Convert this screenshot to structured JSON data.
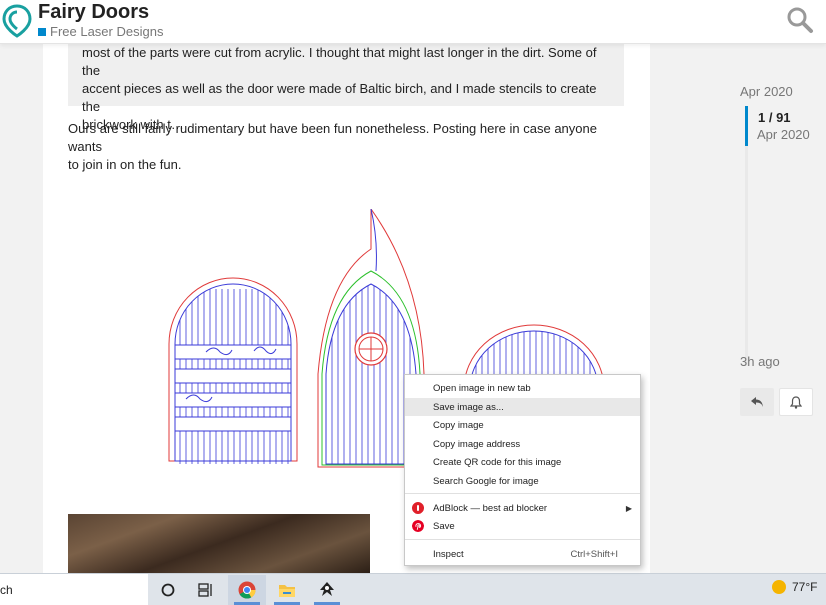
{
  "header": {
    "title": "Fairy Doors",
    "category": "Free Laser Designs",
    "category_color": "#0088cc",
    "logo_icon": "map-pin-logo-icon",
    "search_icon": "search-icon"
  },
  "post": {
    "quote_lines": [
      "most of the parts were cut from acrylic. I thought that might last longer in the dirt. Some of the",
      "accent pieces as well as the door were made of Baltic birch, and I made stencils to create the",
      "brickwork with t…"
    ],
    "body_lines": [
      "Ours are still fairly rudimentary but have been fun nonetheless. Posting here in case anyone wants",
      "to join in on the fun."
    ]
  },
  "timeline": {
    "start_date": "Apr 2020",
    "position": "1 / 91",
    "position_date": "Apr 2020",
    "end_label": "3h ago",
    "reply_icon": "reply-icon",
    "bell_icon": "bell-icon"
  },
  "context_menu": {
    "items": [
      {
        "label": "Open image in new tab"
      },
      {
        "label": "Save image as..."
      },
      {
        "label": "Copy image"
      },
      {
        "label": "Copy image address"
      },
      {
        "label": "Create QR code for this image"
      },
      {
        "label": "Search Google for image"
      },
      {
        "label": "AdBlock — best ad blocker",
        "icon": "adblock-icon",
        "icon_color": "#e0202a",
        "has_submenu": true
      },
      {
        "label": "Save",
        "icon": "pinterest-icon",
        "icon_color": "#e60023"
      },
      {
        "label": "Inspect",
        "shortcut": "Ctrl+Shift+I"
      }
    ],
    "hovered_index": 1
  },
  "taskbar": {
    "search_text": "ch",
    "weather": "77°F",
    "apps": [
      "cortana-icon",
      "task-view-icon",
      "chrome-icon",
      "file-explorer-icon",
      "inkscape-icon"
    ]
  }
}
